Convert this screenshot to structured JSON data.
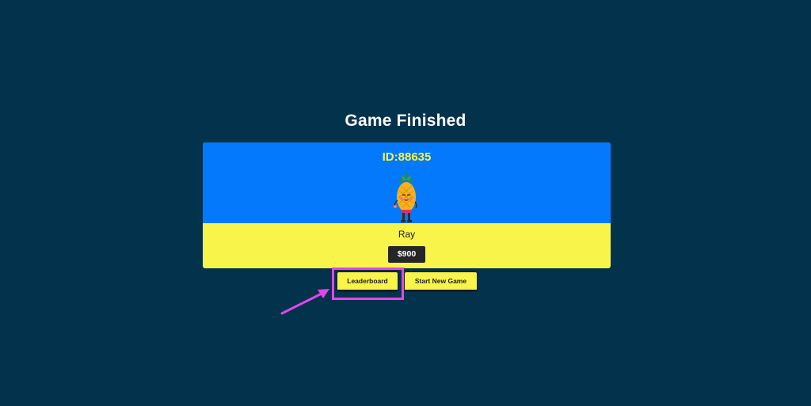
{
  "page": {
    "title": "Game Finished"
  },
  "result_card": {
    "game_id": "ID:88635",
    "player_name": "Ray",
    "score": "$900",
    "avatar_icon": "pineapple-avatar-icon"
  },
  "actions": {
    "leaderboard_label": "Leaderboard",
    "new_game_label": "Start New Game"
  },
  "annotation": {
    "highlight_target": "Leaderboard",
    "highlight_color": "#e544ec"
  },
  "colors": {
    "background": "#03324d",
    "card_top": "#0479fb",
    "card_bottom": "#f8f44a",
    "accent_yellow": "#f8f44a",
    "score_badge": "#262626"
  }
}
